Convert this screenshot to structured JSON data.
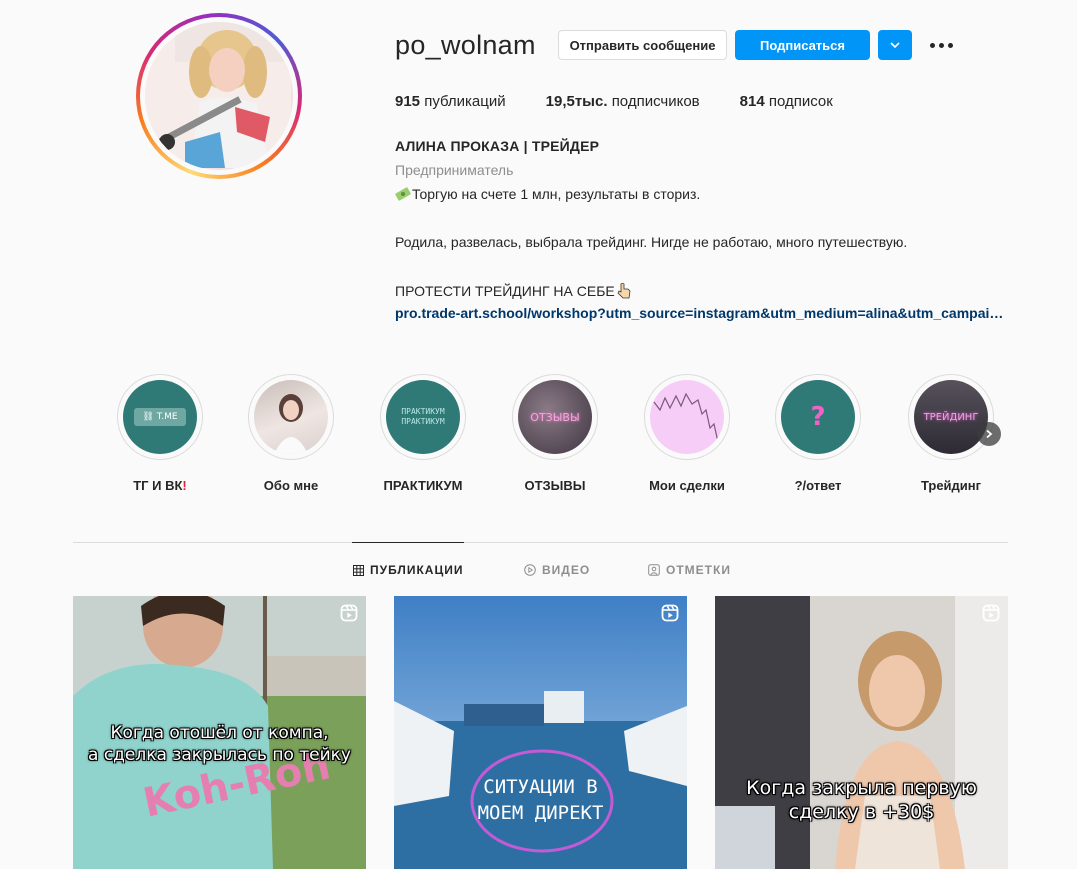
{
  "profile": {
    "username": "po_wolnam",
    "message_button": "Отправить сообщение",
    "follow_button": "Подписаться",
    "stats": {
      "posts_count": "915",
      "posts_label": "публикаций",
      "followers_count": "19,5тыс.",
      "followers_label": "подписчиков",
      "following_count": "814",
      "following_label": "подписок"
    },
    "full_name": "АЛИНА ПРОКАЗА | ТРЕЙДЕР",
    "category": "Предприниматель",
    "bio": {
      "line1": "Торгую на счете 1 млн, результаты в сториз.",
      "line2": "Родила, развелась, выбрала трейдинг. Нигде не работаю, много путешествую.",
      "line3": "ПРОТЕСТИ ТРЕЙДИНГ НА СЕБЕ"
    },
    "link": "pro.trade-art.school/workshop?utm_source=instagram&utm_medium=alina&utm_campaign=bio"
  },
  "highlights": [
    {
      "label": "ТГ И ВК",
      "cover_text": "T.ME",
      "color": "#2f7a76"
    },
    {
      "label": "Обо мне",
      "cover_text": "",
      "color": "#d8cfcf"
    },
    {
      "label": "ПРАКТИКУМ",
      "cover_text": "ПРАКТИКУМ ПРАКТИКУМ",
      "color": "#2f7a76"
    },
    {
      "label": "ОТЗЫВЫ",
      "cover_text": "ОТЗЫВЫ",
      "color": "#5a4a55"
    },
    {
      "label": "Мои сделки",
      "cover_text": "",
      "color": "#f4c8f4"
    },
    {
      "label": "?/ответ",
      "cover_text": "?",
      "color": "#2f7a76"
    },
    {
      "label": "Трейдинг",
      "cover_text": "ТРЕЙДИНГ",
      "color": "#3d3d45"
    }
  ],
  "tabs": {
    "posts": "ПУБЛИКАЦИИ",
    "videos": "ВИДЕО",
    "tagged": "ОТМЕТКИ"
  },
  "posts": [
    {
      "caption_line1": "Когда отошёл от компа,",
      "caption_line2": "а сделка закрылась по тейку",
      "icon": "reels-icon"
    },
    {
      "caption_line1": "СИТУАЦИИ В",
      "caption_line2": "МОЕМ ДИРЕКТ",
      "icon": "reels-icon"
    },
    {
      "caption_line1": "Когда закрыла первую",
      "caption_line2": "сделку в +30$",
      "icon": "reels-icon"
    }
  ],
  "colors": {
    "accent": "#0095f6",
    "link": "#00376b",
    "muted": "#8e8e8e"
  }
}
